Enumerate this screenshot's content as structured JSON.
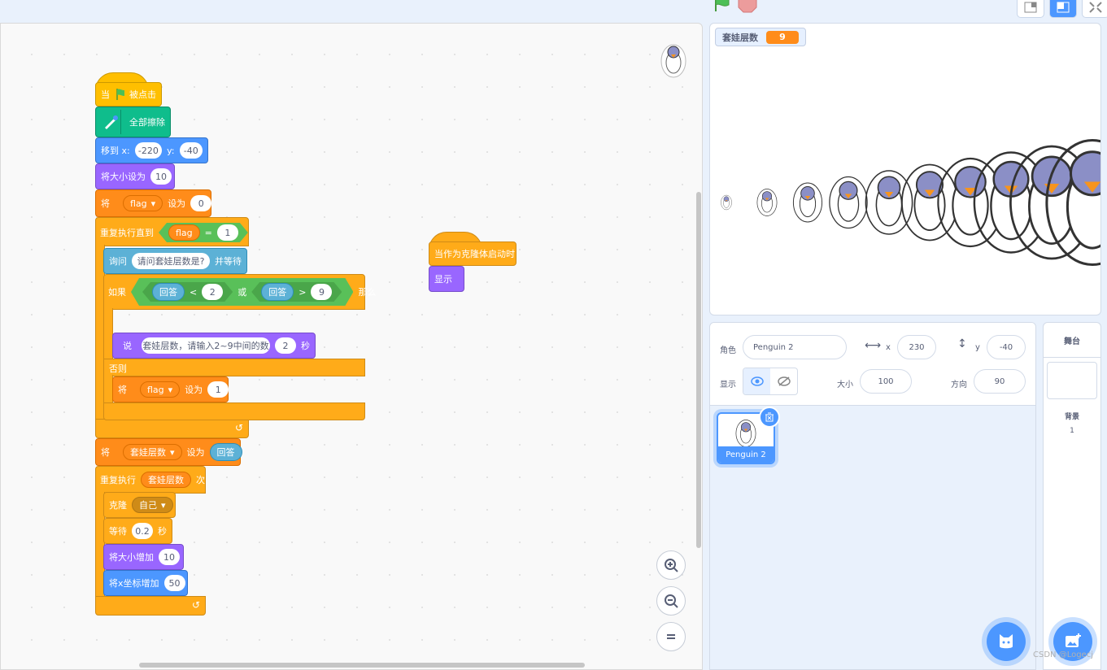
{
  "stage_monitor": {
    "label": "套娃层数",
    "value": "9"
  },
  "sprite_info": {
    "sprite_label": "角色",
    "sprite_name": "Penguin 2",
    "x_label": "x",
    "x_value": "230",
    "y_label": "y",
    "y_value": "-40",
    "show_label": "显示",
    "size_label": "大小",
    "size_value": "100",
    "direction_label": "方向",
    "direction_value": "90"
  },
  "sprites": [
    {
      "name": "Penguin 2",
      "selected": true
    }
  ],
  "stage_panel": {
    "title": "舞台",
    "backdrops_label": "背景",
    "backdrops_count": "1"
  },
  "watermark": "CSDN @Logecj",
  "script1": {
    "hat": {
      "when": "当",
      "clicked": "被点击"
    },
    "erase_all": "全部擦除",
    "goto": {
      "label": "移到 x:",
      "x": "-220",
      "y_label": "y:",
      "y": "-40"
    },
    "set_size": {
      "label": "将大小设为",
      "value": "10"
    },
    "set_flag": {
      "set": "将",
      "var": "flag",
      "to": "设为",
      "value": "0"
    },
    "repeat_until": {
      "label": "重复执行直到",
      "var": "flag",
      "op": "=",
      "value": "1"
    },
    "ask": {
      "label": "询问",
      "question": "请问套娃层数是?",
      "and_wait": "并等待"
    },
    "if": {
      "label": "如果",
      "answer1": "回答",
      "lt": "<",
      "value1": "2",
      "or": "或",
      "answer2": "回答",
      "gt": ">",
      "value2": "9",
      "then": "那么"
    },
    "say": {
      "label": "说",
      "text": "套娃层数，请输入2~9中间的数",
      "secs": "2",
      "secs_label": "秒"
    },
    "else": "否则",
    "set_flag2": {
      "set": "将",
      "var": "flag",
      "to": "设为",
      "value": "1"
    },
    "set_layers": {
      "set": "将",
      "var": "套娃层数",
      "to": "设为",
      "answer": "回答"
    },
    "repeat": {
      "label": "重复执行",
      "var": "套娃层数",
      "times": "次"
    },
    "clone": {
      "label": "克隆",
      "target": "自己"
    },
    "wait": {
      "label": "等待",
      "value": "0.2",
      "secs": "秒"
    },
    "change_size": {
      "label": "将大小增加",
      "value": "10"
    },
    "change_x": {
      "label": "将x坐标增加",
      "value": "50"
    }
  },
  "script2": {
    "hat": "当作为克隆体启动时",
    "show": "显示"
  }
}
